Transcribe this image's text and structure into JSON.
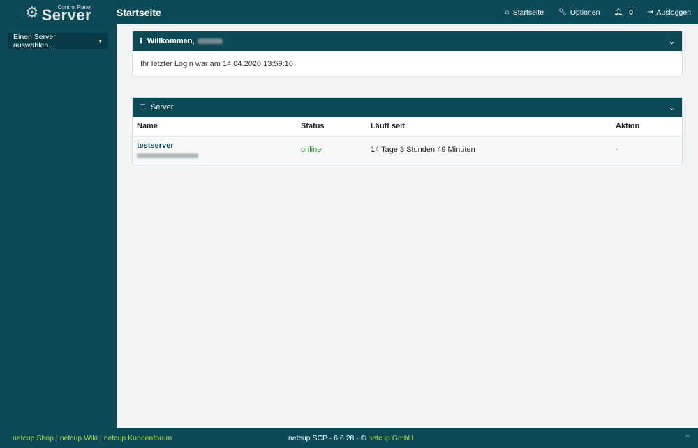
{
  "header": {
    "logo_small": "Control Panel",
    "logo_big": "Server",
    "page_title": "Startseite",
    "nav": [
      {
        "icon": "home-icon",
        "label": "Startseite"
      },
      {
        "icon": "wrench-icon",
        "label": "Optionen"
      },
      {
        "icon": "bell-icon",
        "label": "",
        "badge": "0"
      },
      {
        "icon": "logout-icon",
        "label": "Ausloggen"
      }
    ]
  },
  "sidebar": {
    "server_select_label": "Einen Server auswählen..."
  },
  "welcome": {
    "title": "Willkommen,",
    "last_login": "Ihr letzter Login war am 14.04.2020 13:59:16"
  },
  "servers": {
    "title": "Server",
    "columns": [
      "Name",
      "Status",
      "Läuft seit",
      "Aktion"
    ],
    "rows": [
      {
        "name": "testserver",
        "status": "online",
        "uptime": "14 Tage 3 Stunden 49 Minuten",
        "action": "-"
      }
    ]
  },
  "footer": {
    "links": [
      "netcup Shop",
      "netcup Wiki",
      "netcup Kundenforum"
    ],
    "version_text": "netcup SCP - 6.6.28 - ©",
    "company": "netcup GmbH"
  },
  "colors": {
    "primary": "#0d4a57",
    "accent": "#b6d83a",
    "online": "#2e8b2e"
  }
}
